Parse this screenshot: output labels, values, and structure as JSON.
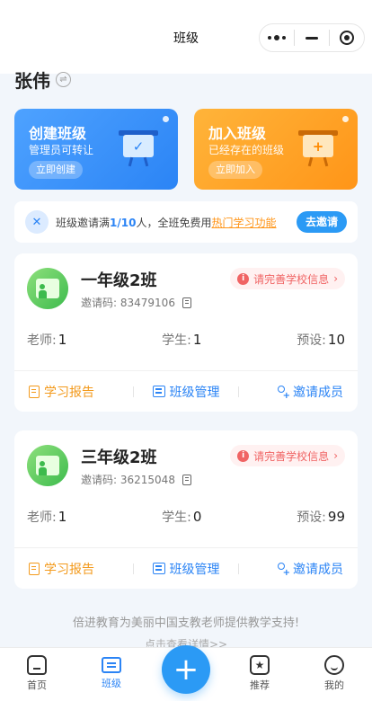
{
  "header": {
    "title": "班级"
  },
  "user": {
    "name": "张伟"
  },
  "actions": {
    "create": {
      "title": "创建班级",
      "subtitle": "管理员可转让",
      "button": "立即创建"
    },
    "join": {
      "title": "加入班级",
      "subtitle": "已经存在的班级",
      "button": "立即加入"
    }
  },
  "invite_banner": {
    "text_prefix": "班级邀请满",
    "progress": "1/10",
    "text_mid": "人，全班免费用",
    "link": "热门学习功能",
    "button": "去邀请"
  },
  "classes": [
    {
      "name": "一年级2班",
      "code_label": "邀请码:",
      "code": "83479106",
      "warning": "请完善学校信息",
      "teachers_label": "老师:",
      "teachers": "1",
      "students_label": "学生:",
      "students": "1",
      "presets_label": "预设:",
      "presets": "10",
      "report_label": "学习报告",
      "manage_label": "班级管理",
      "invite_label": "邀请成员"
    },
    {
      "name": "三年级2班",
      "code_label": "邀请码:",
      "code": "36215048",
      "warning": "请完善学校信息",
      "teachers_label": "老师:",
      "teachers": "1",
      "students_label": "学生:",
      "students": "0",
      "presets_label": "预设:",
      "presets": "99",
      "report_label": "学习报告",
      "manage_label": "班级管理",
      "invite_label": "邀请成员"
    }
  ],
  "footer": {
    "note": "倍进教育为美丽中国支教老师提供教学支持!",
    "link": "点击查看详情>>"
  },
  "tabbar": {
    "home": "首页",
    "class": "班级",
    "recommend": "推荐",
    "mine": "我的",
    "fab": "+"
  },
  "colors": {
    "primary": "#2b84f5",
    "orange": "#ff9518",
    "warning": "#f06464"
  }
}
